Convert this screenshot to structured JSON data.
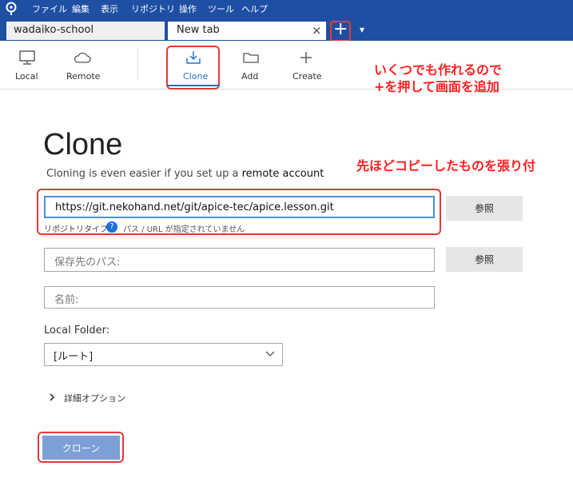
{
  "menu": {
    "items": [
      "ファイル",
      "編集",
      "表示",
      "リポジトリ",
      "操作",
      "ツール",
      "ヘルプ"
    ]
  },
  "tabs": [
    {
      "label": "wadaiko-school"
    },
    {
      "label": "New tab"
    }
  ],
  "tab_close": "×",
  "add_tab": "+",
  "tab_dropdown": "▾",
  "toolbar": {
    "items": [
      {
        "label": "Local",
        "icon": "monitor-icon"
      },
      {
        "label": "Remote",
        "icon": "cloud-icon"
      },
      {
        "label": "Clone",
        "icon": "download-icon"
      },
      {
        "label": "Add",
        "icon": "folder-icon"
      },
      {
        "label": "Create",
        "icon": "plus-icon"
      }
    ],
    "active": "Clone",
    "accent": "#1f6fd1"
  },
  "clone": {
    "heading": "Clone",
    "subtitle_prefix": "Cloning is even easier if you set up a ",
    "subtitle_link": "remote account",
    "url_value": "https://git.nekohand.net/git/apice-tec/apice.lesson.git",
    "repo_type_label": "リポジトリタイプ:",
    "repo_type_help": "?",
    "repo_type_status": "パス / URL が指定されていません",
    "browse_label": "参照",
    "dest_placeholder": "保存先のパス:",
    "name_placeholder": "名前:",
    "local_folder_label": "Local Folder:",
    "local_folder_value": "[ルート]",
    "advanced_label": "詳細オプション",
    "clone_button": "クローン"
  },
  "annotations": {
    "tab_note_line1": "いくつでも作れるので",
    "tab_note_line2": "+を押して画面を追加",
    "paste_note": "先ほどコピーしたものを張り付"
  },
  "colors": {
    "title_bar": "#1f4fa3",
    "annotation_red": "#e53935",
    "clone_button": "#7aa0d6"
  }
}
